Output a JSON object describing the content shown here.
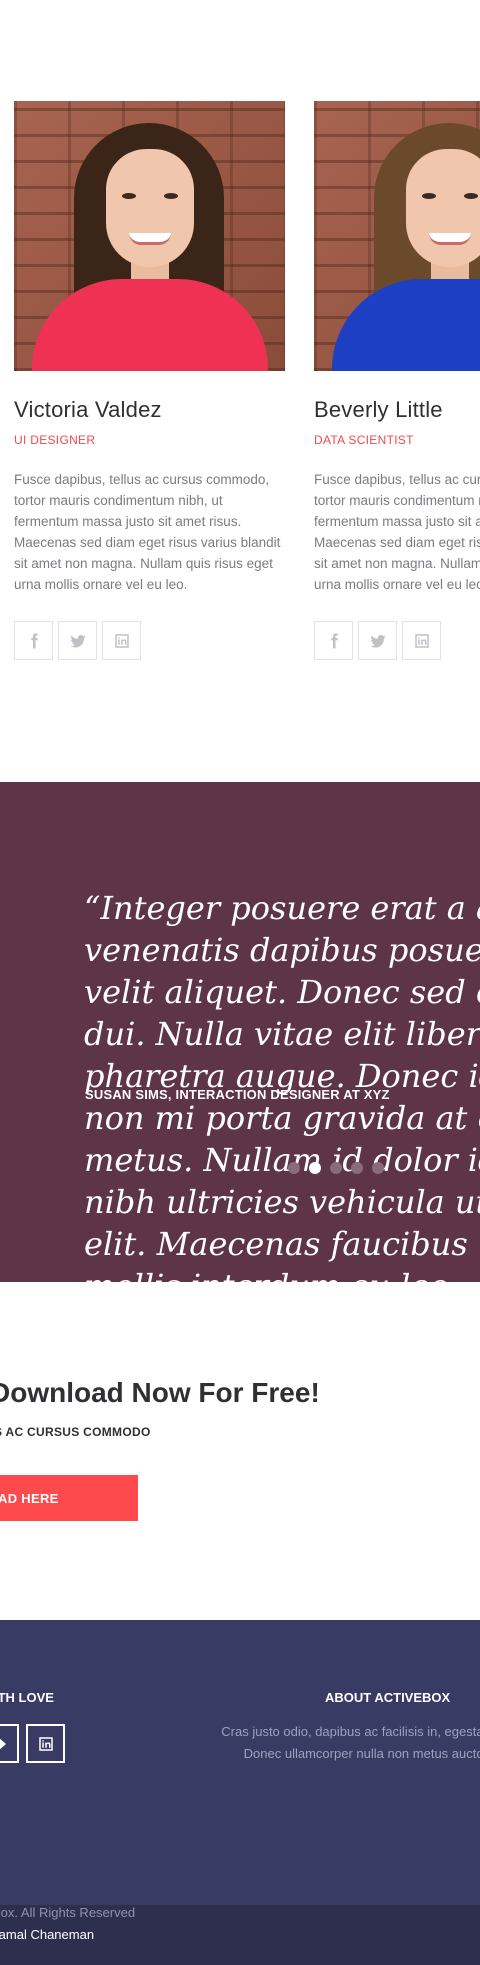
{
  "team": {
    "members": [
      {
        "name": "Victoria Valdez",
        "role": "UI DESIGNER",
        "bio": "Fusce dapibus, tellus ac cursus commodo, tortor mauris condimentum nibh, ut fermentum massa justo sit amet risus. Maecenas sed diam eget risus varius blandit sit amet non magna. Nullam quis risus eget urna mollis ornare vel eu leo.",
        "shirt_color": "#ef3254",
        "socials": [
          "facebook-icon",
          "twitter-icon",
          "linkedin-icon"
        ]
      },
      {
        "name": "Beverly Little",
        "role": "DATA SCIENTIST",
        "bio": "Fusce dapibus, tellus ac cursus commodo, tortor mauris condimentum nibh, ut fermentum massa justo sit amet risus. Maecenas sed diam eget risus varius blandit sit amet non magna. Nullam quis risus eget urna mollis ornare vel eu leo.",
        "shirt_color": "#1d3fc4",
        "socials": [
          "facebook-icon",
          "twitter-icon",
          "linkedin-icon"
        ]
      }
    ]
  },
  "testimonial": {
    "quote": "“Integer posuere erat a ante venenatis dapibus posuere velit aliquet. Donec sed odio dui. Nulla vitae elit libero, a pharetra augue. Donec id elit non mi porta gravida at eget metus. Nullam id dolor id nibh ultricies vehicula ut id elit. Maecenas faucibus mollis interdum eu leo quam...”",
    "author": "SUSAN SIMS, INTERACTION DESIGNER AT XYZ",
    "slides": 5,
    "active_slide": 2,
    "background": "#5d3448"
  },
  "download": {
    "title": "Download Now For Free!",
    "subtitle": "S AC CURSUS COMMODO",
    "button_label": "AD HERE",
    "accent": "#ff4a4d"
  },
  "footer": {
    "love_heading": "ITH LOVE",
    "about_heading": "ABOUT ACTIVEBOX",
    "about_text": "Cras justo odio, dapibus ac facilisis in, egestas eget quam. Donec ullamcorper nulla non metus auctor fringilla.",
    "copyright": "Box. All Rights Reserved",
    "author_line": "Kamal Chaneman",
    "background": "#383b63"
  }
}
